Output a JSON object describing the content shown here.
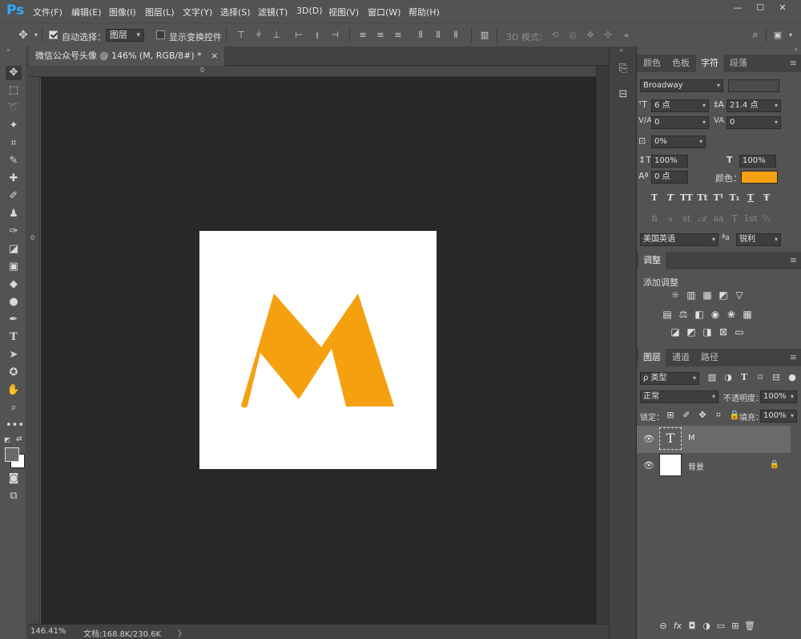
{
  "app": {
    "logo": "Ps"
  },
  "menu": [
    "文件(F)",
    "编辑(E)",
    "图像(I)",
    "图层(L)",
    "文字(Y)",
    "选择(S)",
    "滤镜(T)",
    "3D(D)",
    "视图(V)",
    "窗口(W)",
    "帮助(H)"
  ],
  "window_controls": {
    "minimize": "—",
    "maximize": "☐",
    "close": "✕"
  },
  "options": {
    "auto_select_label": "自动选择：",
    "auto_select_checked": true,
    "auto_select_value": "图层",
    "show_transform_label": "显示变换控件",
    "show_transform_checked": false,
    "mode_3d_label": "3D 模式："
  },
  "document": {
    "tab_title": "微信公众号头像 @ 146% (M, RGB/8#) *",
    "tab_close": "×",
    "ruler_top_zero": "0",
    "ruler_left_zero": "0",
    "letter": "M",
    "letter_color": "#f5a00f",
    "canvas_color": "#ffffff"
  },
  "status": {
    "zoom": "146.41%",
    "doc_size": "文档:168.8K/230.6K",
    "arrow": "〉"
  },
  "character_panel": {
    "tabs": [
      "颜色",
      "色板",
      "字符",
      "段落"
    ],
    "active_tab": "字符",
    "font_family": "Broadway",
    "font_style": "",
    "font_size": "6 点",
    "leading": "21.4 点",
    "kerning": "0",
    "tracking": "0",
    "scale_pct": "0%",
    "vertical_scale": "100%",
    "horizontal_scale": "100%",
    "baseline_shift": "0 点",
    "color_label": "颜色：",
    "color_value": "#f5a00f",
    "language": "美国英语",
    "aa_icon": "ªa",
    "antialias": "锐利",
    "style_glyphs": [
      "T",
      "T",
      "TT",
      "Tt",
      "T¹",
      "T₁",
      "T",
      "Ŧ"
    ],
    "opentype_glyphs": [
      "fi",
      "ℴ",
      "st",
      "𝒜",
      "aa",
      "T",
      "1st",
      "½"
    ]
  },
  "adjustments_panel": {
    "tab": "调整",
    "add_label": "添加调整",
    "row1": [
      "☼",
      "▥",
      "▦",
      "◩",
      "▽"
    ],
    "row2": [
      "▤",
      "⚖",
      "◧",
      "◉",
      "❀",
      "▦"
    ],
    "row3": [
      "◪",
      "◩",
      "◨",
      "⊠",
      "▭"
    ]
  },
  "layers_panel": {
    "tabs": [
      "图层",
      "通道",
      "路径"
    ],
    "active_tab": "图层",
    "filter_kind": "ρ 类型",
    "blend_mode": "正常",
    "opacity_label": "不透明度：",
    "opacity": "100%",
    "lock_label": "锁定：",
    "fill_label": "填充：",
    "fill": "100%",
    "layers": [
      {
        "name": "M",
        "type": "text",
        "thumb": "T",
        "selected": true
      },
      {
        "name": "背景",
        "type": "background",
        "locked": true,
        "selected": false
      }
    ],
    "bottom_icons": [
      "⊖",
      "fx",
      "◘",
      "◑",
      "▭",
      "⊞",
      "🗑"
    ]
  }
}
